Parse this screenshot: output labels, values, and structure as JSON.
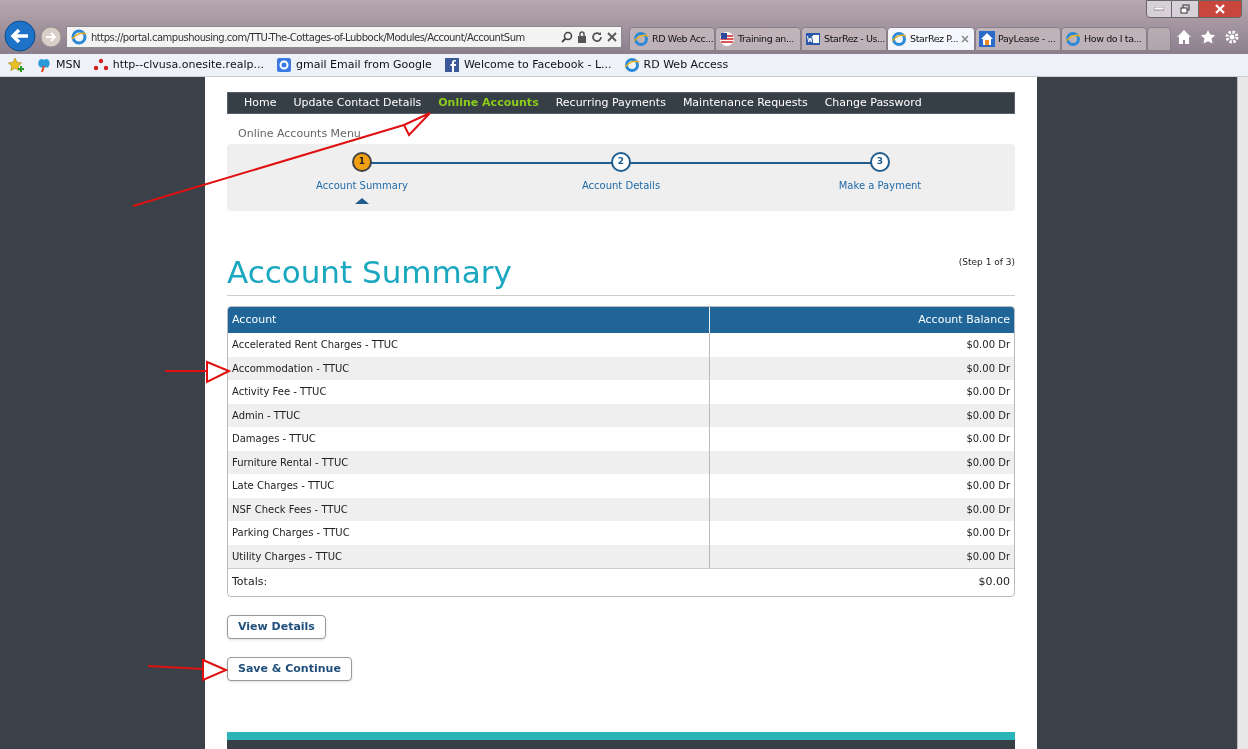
{
  "browser": {
    "address": "https://portal.campushousing.com/TTU-The-Cottages-of-Lubbock/Modules/Account/AccountSum",
    "tabs": [
      {
        "label": "RD Web Acc...",
        "kind": "ie",
        "selected": false
      },
      {
        "label": "Training an...",
        "kind": "flag",
        "selected": false
      },
      {
        "label": "StarRez - Us...",
        "kind": "word",
        "selected": false
      },
      {
        "label": "StarRez P...",
        "kind": "ie",
        "selected": true
      },
      {
        "label": "PayLease - ...",
        "kind": "house",
        "selected": false
      },
      {
        "label": "How do I ta...",
        "kind": "ie",
        "selected": false
      }
    ],
    "favorites": [
      {
        "label": "MSN",
        "kind": "msn"
      },
      {
        "label": "http--clvusa.onesite.realp...",
        "kind": "dots"
      },
      {
        "label": "gmail Email from Google",
        "kind": "google"
      },
      {
        "label": "Welcome to Facebook - L...",
        "kind": "facebook"
      },
      {
        "label": "RD Web Access",
        "kind": "ie"
      }
    ]
  },
  "nav": [
    {
      "label": "Home",
      "selected": false
    },
    {
      "label": "Update Contact Details",
      "selected": false
    },
    {
      "label": "Online Accounts",
      "selected": true
    },
    {
      "label": "Recurring Payments",
      "selected": false
    },
    {
      "label": "Maintenance Requests",
      "selected": false
    },
    {
      "label": "Change Password",
      "selected": false
    }
  ],
  "menu_title": "Online Accounts Menu",
  "steps": [
    {
      "number": "1",
      "label": "Account Summary",
      "selected": true
    },
    {
      "number": "2",
      "label": "Account Details",
      "selected": false
    },
    {
      "number": "3",
      "label": "Make a Payment",
      "selected": false
    }
  ],
  "heading": "Account Summary",
  "step_note": "(Step 1 of 3)",
  "table": {
    "columns": [
      "Account",
      "Account Balance"
    ],
    "rows": [
      [
        "Accelerated Rent Charges - TTUC",
        "$0.00 Dr"
      ],
      [
        "Accommodation - TTUC",
        "$0.00 Dr"
      ],
      [
        "Activity Fee - TTUC",
        "$0.00 Dr"
      ],
      [
        "Admin - TTUC",
        "$0.00 Dr"
      ],
      [
        "Damages - TTUC",
        "$0.00 Dr"
      ],
      [
        "Furniture Rental - TTUC",
        "$0.00 Dr"
      ],
      [
        "Late Charges - TTUC",
        "$0.00 Dr"
      ],
      [
        "NSF Check Fees - TTUC",
        "$0.00 Dr"
      ],
      [
        "Parking Charges - TTUC",
        "$0.00 Dr"
      ],
      [
        "Utility Charges - TTUC",
        "$0.00 Dr"
      ]
    ],
    "totals": {
      "label": "Totals:",
      "value": "$0.00"
    }
  },
  "buttons": [
    "View Details",
    "Save & Continue"
  ]
}
